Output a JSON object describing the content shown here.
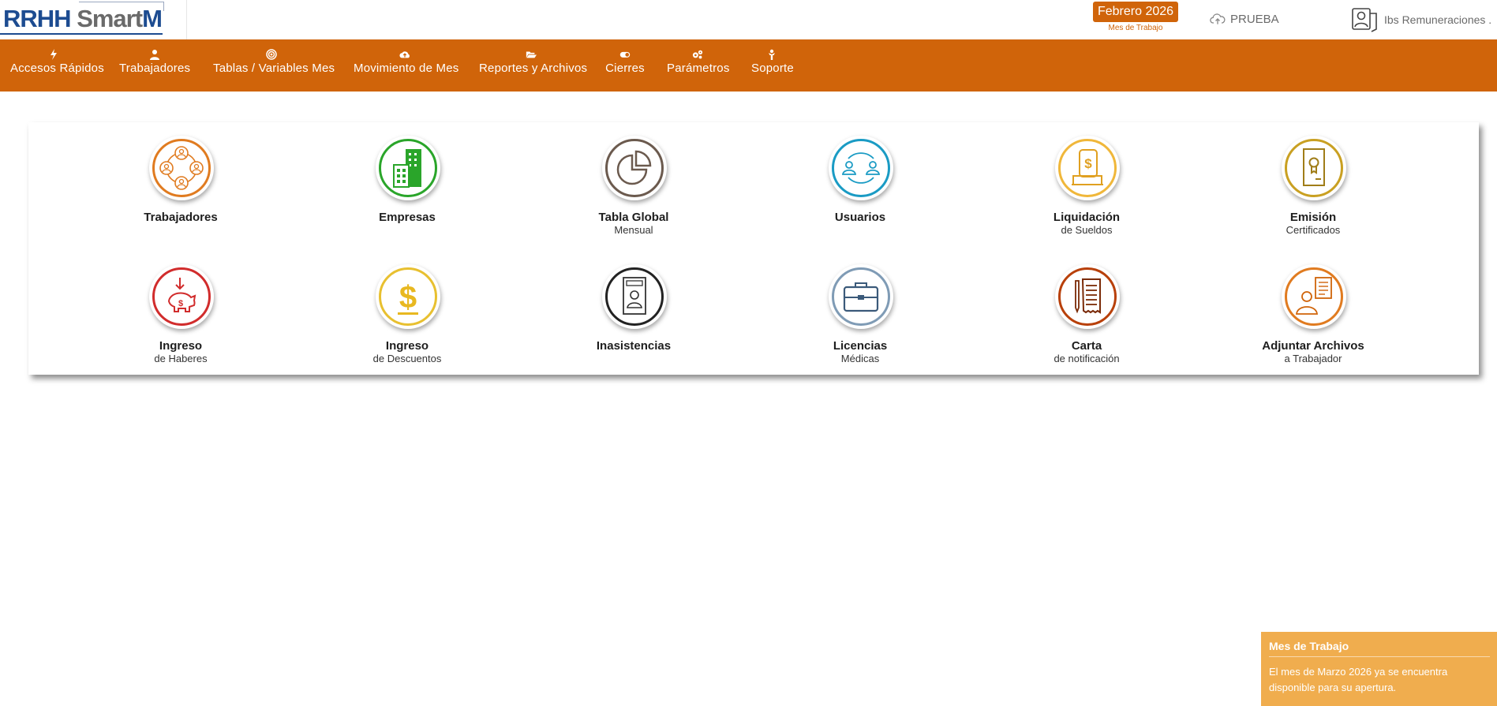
{
  "header": {
    "logo_text_main": "RRHH",
    "logo_text_smart": "Smart",
    "logo_text_m": "M",
    "month_badge": "Febrero 2026",
    "month_caption": "Mes de Trabajo",
    "cloud_label": "PRUEBA",
    "user_label": "Ibs Remuneraciones ."
  },
  "nav": {
    "items": [
      {
        "label": "Accesos Rápidos",
        "icon": "bolt-icon"
      },
      {
        "label": "Trabajadores",
        "icon": "user-icon"
      },
      {
        "label": "Tablas / Variables Mes",
        "icon": "target-icon"
      },
      {
        "label": "Movimiento de Mes",
        "icon": "cloud-upload-icon"
      },
      {
        "label": "Reportes y Archivos",
        "icon": "folder-open-icon"
      },
      {
        "label": "Cierres",
        "icon": "toggle-icon"
      },
      {
        "label": "Parámetros",
        "icon": "gears-icon"
      },
      {
        "label": "Soporte",
        "icon": "support-icon"
      }
    ]
  },
  "tiles": [
    {
      "title": "Trabajadores",
      "subtitle": "",
      "icon": "people-network-icon",
      "color": "#e07b20"
    },
    {
      "title": "Empresas",
      "subtitle": "",
      "icon": "buildings-icon",
      "color": "#2aa52a"
    },
    {
      "title": "Tabla Global",
      "subtitle": "Mensual",
      "icon": "pie-chart-icon",
      "color": "#6b5a4e"
    },
    {
      "title": "Usuarios",
      "subtitle": "",
      "icon": "users-exchange-icon",
      "color": "#1a9bc4"
    },
    {
      "title": "Liquidación",
      "subtitle": "de Sueldos",
      "icon": "payslip-icon",
      "color": "#f0b73a"
    },
    {
      "title": "Emisión",
      "subtitle": "Certificados",
      "icon": "certificate-icon",
      "color": "#c9a022"
    },
    {
      "title": "Ingreso",
      "subtitle": "de Haberes",
      "icon": "piggy-bank-icon",
      "color": "#d12c2c"
    },
    {
      "title": "Ingreso",
      "subtitle": "de Descuentos",
      "icon": "dollar-icon",
      "color": "#e8c030"
    },
    {
      "title": "Inasistencias",
      "subtitle": "",
      "icon": "id-card-icon",
      "color": "#222222"
    },
    {
      "title": "Licencias",
      "subtitle": "Médicas",
      "icon": "briefcase-icon",
      "color": "#5b7a99"
    },
    {
      "title": "Carta",
      "subtitle": "de notificación",
      "icon": "receipt-icon",
      "color": "#b8400a"
    },
    {
      "title": "Adjuntar Archivos",
      "subtitle": "a Trabajador",
      "icon": "user-file-icon",
      "color": "#e07b20"
    }
  ],
  "toast": {
    "title": "Mes de Trabajo",
    "body": "El mes de Marzo 2026 ya se encuentra disponible para su apertura."
  }
}
